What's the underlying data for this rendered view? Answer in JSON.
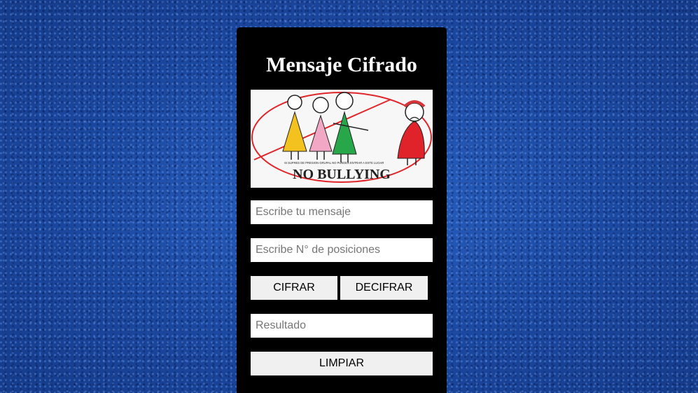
{
  "title": "Mensaje Cifrado",
  "banner": {
    "headline": "NO BULLYING",
    "small_text": "SI SUFRES DE  PRESION GRUPAL NO PUEDES ENTRAR A ESTE LUGAR"
  },
  "inputs": {
    "message_placeholder": "Escribe tu mensaje",
    "positions_placeholder": "Escribe N° de posiciones",
    "result_placeholder": "Resultado"
  },
  "buttons": {
    "encrypt": "CIFRAR",
    "decrypt": "DECIFRAR",
    "clear": "LIMPIAR"
  },
  "colors": {
    "background": "#1f4fa8",
    "card": "#000000",
    "button": "#f0f0f0"
  }
}
